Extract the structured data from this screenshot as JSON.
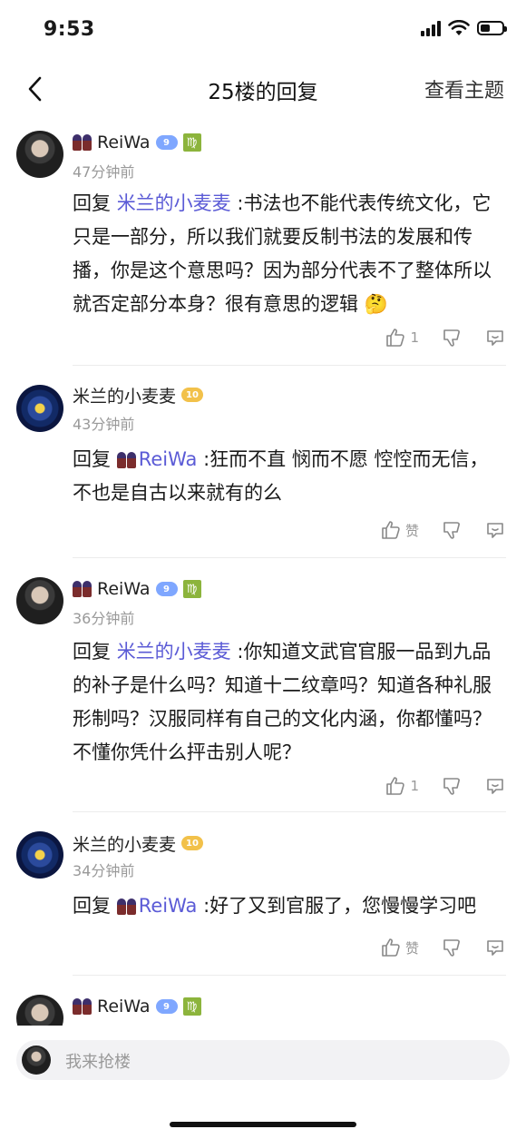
{
  "status": {
    "time": "9:53",
    "battery_level": 0.45
  },
  "nav": {
    "title": "25楼的回复",
    "action": "查看主题"
  },
  "replies": [
    {
      "username": "ReiWa",
      "level": "9",
      "zodiac": "♍",
      "time": "47分钟前",
      "prefix": "回复 ",
      "mention": "米兰的小麦麦",
      "text": " :书法也不能代表传统文化，它只是一部分，所以我们就要反制书法的发展和传播，你是这个意思吗？因为部分代表不了整体所以就否定部分本身？很有意思的逻辑 🤔",
      "like_label": "1"
    },
    {
      "username": "米兰的小麦麦",
      "level": "10",
      "time": "43分钟前",
      "prefix": "回复 ",
      "mention": "ReiWa",
      "text": " :狂而不直 悯而不愿 悾悾而无信，不也是自古以来就有的么",
      "like_label": "赞"
    },
    {
      "username": "ReiWa",
      "level": "9",
      "zodiac": "♍",
      "time": "36分钟前",
      "prefix": "回复 ",
      "mention": "米兰的小麦麦",
      "text": " :你知道文武官官服一品到九品的补子是什么吗？知道十二纹章吗？知道各种礼服形制吗？汉服同样有自己的文化内涵，你都懂吗？不懂你凭什么抨击别人呢？",
      "like_label": "1"
    },
    {
      "username": "米兰的小麦麦",
      "level": "10",
      "time": "34分钟前",
      "prefix": "回复 ",
      "mention": "ReiWa",
      "text": " :好了又到官服了，您慢慢学习吧",
      "like_label": "赞"
    },
    {
      "username": "ReiWa",
      "level": "9",
      "zodiac": "♍"
    }
  ],
  "input": {
    "placeholder": "我来抢楼"
  }
}
